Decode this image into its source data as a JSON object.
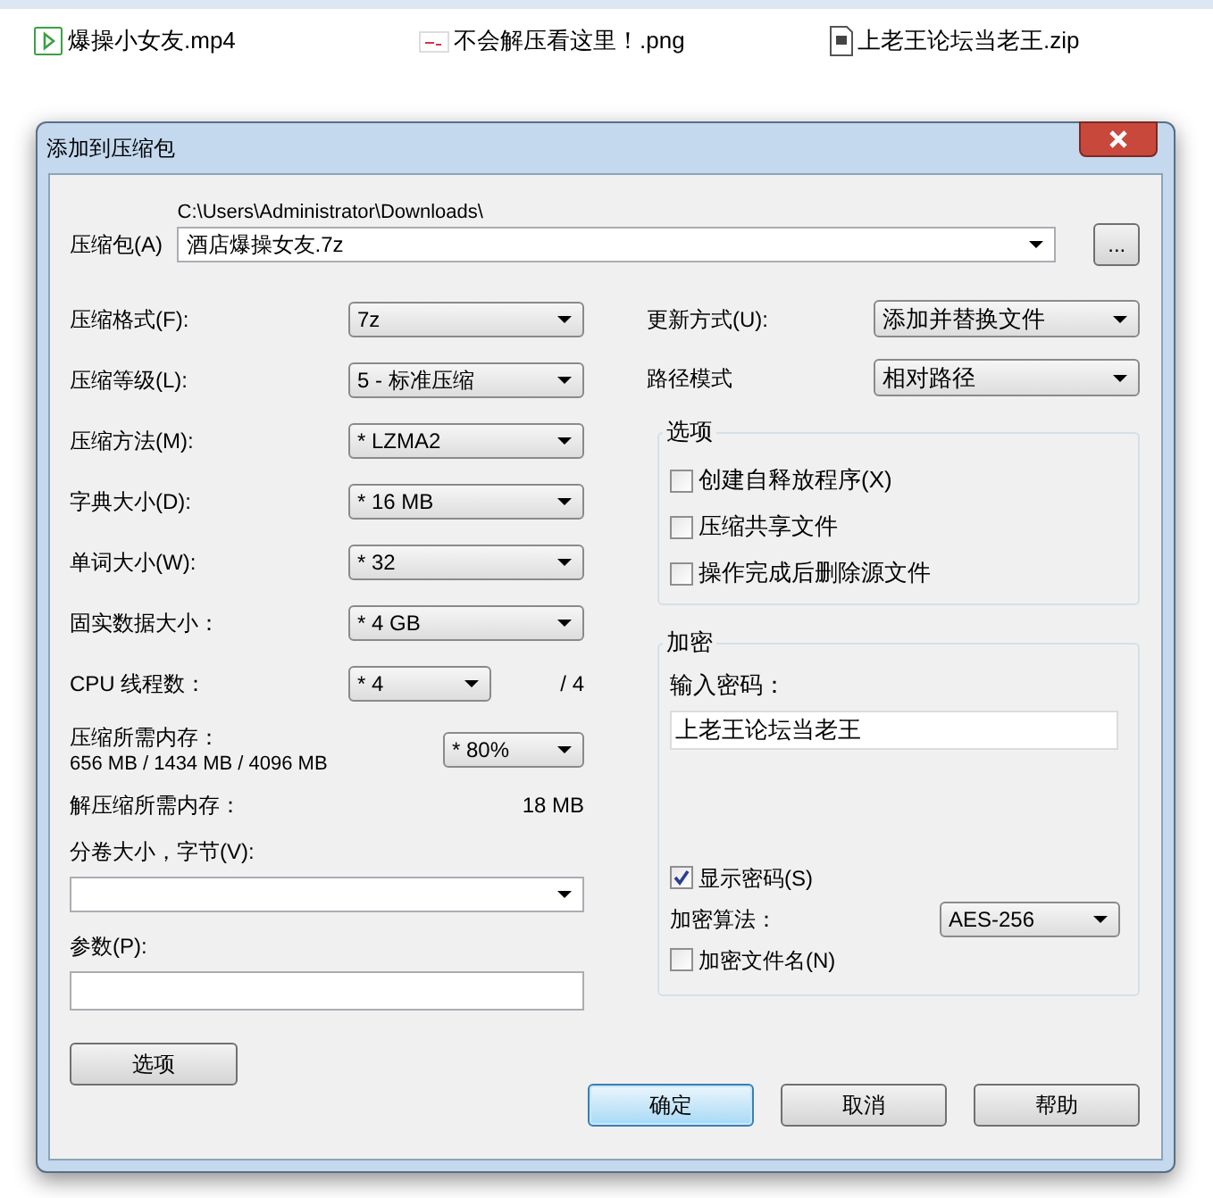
{
  "files": [
    {
      "kind": "video",
      "name": "爆操小女友.mp4"
    },
    {
      "kind": "image",
      "name": "不会解压看这里！.png"
    },
    {
      "kind": "archive",
      "name": "上老王论坛当老王.zip"
    }
  ],
  "dialog": {
    "title": "添加到压缩包",
    "archive": {
      "label": "压缩包(A)",
      "path": "C:\\Users\\Administrator\\Downloads\\",
      "value": "酒店爆操女友.7z",
      "browse": "..."
    },
    "left_rows": [
      {
        "kind": "combo",
        "label": "压缩格式(F):",
        "value": "7z"
      },
      {
        "kind": "combo",
        "label": "压缩等级(L):",
        "value": "5 - 标准压缩"
      },
      {
        "kind": "combo",
        "label": "压缩方法(M):",
        "value": "* LZMA2"
      },
      {
        "kind": "combo",
        "label": "字典大小(D):",
        "value": "* 16 MB"
      },
      {
        "kind": "combo",
        "label": "单词大小(W):",
        "value": "* 32"
      },
      {
        "kind": "combo",
        "label": "固实数据大小：",
        "value": "* 4 GB"
      },
      {
        "kind": "short_combo",
        "label": "CPU 线程数：",
        "value": "* 4",
        "suffix": "/ 4"
      },
      {
        "kind": "memory",
        "label": "压缩所需内存：",
        "detail": "656 MB / 1434 MB / 4096 MB",
        "value": "* 80%"
      },
      {
        "kind": "info",
        "label": "解压缩所需内存：",
        "value": "18 MB"
      },
      {
        "kind": "wide_combo",
        "label": "分卷大小，字节(V):"
      },
      {
        "kind": "field",
        "label": "参数(P):"
      }
    ],
    "update": {
      "label": "更新方式(U):",
      "value": "添加并替换文件"
    },
    "path_mode": {
      "label": "路径模式",
      "value": "相对路径"
    },
    "options": {
      "title": "选项",
      "items": [
        {
          "label": "创建自释放程序(X)",
          "checked": false
        },
        {
          "label": "压缩共享文件",
          "checked": false
        },
        {
          "label": "操作完成后删除源文件",
          "checked": false
        }
      ]
    },
    "encryption": {
      "title": "加密",
      "password_label": "输入密码：",
      "password": "上老王论坛当老王",
      "show_password": {
        "label": "显示密码(S)",
        "checked": true
      },
      "method_label": "加密算法：",
      "method": "AES-256",
      "encrypt_names": {
        "label": "加密文件名(N)",
        "checked": false
      }
    },
    "options_button": "选项",
    "buttons": [
      {
        "label": "确定",
        "default": true
      },
      {
        "label": "取消",
        "default": false
      },
      {
        "label": "帮助",
        "default": false
      }
    ]
  }
}
